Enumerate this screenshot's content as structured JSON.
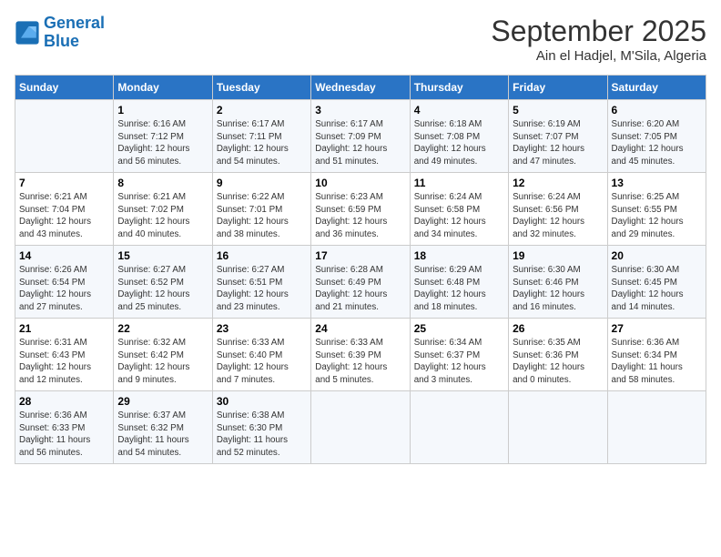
{
  "logo": {
    "line1": "General",
    "line2": "Blue"
  },
  "title": "September 2025",
  "subtitle": "Ain el Hadjel, M'Sila, Algeria",
  "days_of_week": [
    "Sunday",
    "Monday",
    "Tuesday",
    "Wednesday",
    "Thursday",
    "Friday",
    "Saturday"
  ],
  "weeks": [
    [
      {
        "day": "",
        "info": ""
      },
      {
        "day": "1",
        "info": "Sunrise: 6:16 AM\nSunset: 7:12 PM\nDaylight: 12 hours\nand 56 minutes."
      },
      {
        "day": "2",
        "info": "Sunrise: 6:17 AM\nSunset: 7:11 PM\nDaylight: 12 hours\nand 54 minutes."
      },
      {
        "day": "3",
        "info": "Sunrise: 6:17 AM\nSunset: 7:09 PM\nDaylight: 12 hours\nand 51 minutes."
      },
      {
        "day": "4",
        "info": "Sunrise: 6:18 AM\nSunset: 7:08 PM\nDaylight: 12 hours\nand 49 minutes."
      },
      {
        "day": "5",
        "info": "Sunrise: 6:19 AM\nSunset: 7:07 PM\nDaylight: 12 hours\nand 47 minutes."
      },
      {
        "day": "6",
        "info": "Sunrise: 6:20 AM\nSunset: 7:05 PM\nDaylight: 12 hours\nand 45 minutes."
      }
    ],
    [
      {
        "day": "7",
        "info": "Sunrise: 6:21 AM\nSunset: 7:04 PM\nDaylight: 12 hours\nand 43 minutes."
      },
      {
        "day": "8",
        "info": "Sunrise: 6:21 AM\nSunset: 7:02 PM\nDaylight: 12 hours\nand 40 minutes."
      },
      {
        "day": "9",
        "info": "Sunrise: 6:22 AM\nSunset: 7:01 PM\nDaylight: 12 hours\nand 38 minutes."
      },
      {
        "day": "10",
        "info": "Sunrise: 6:23 AM\nSunset: 6:59 PM\nDaylight: 12 hours\nand 36 minutes."
      },
      {
        "day": "11",
        "info": "Sunrise: 6:24 AM\nSunset: 6:58 PM\nDaylight: 12 hours\nand 34 minutes."
      },
      {
        "day": "12",
        "info": "Sunrise: 6:24 AM\nSunset: 6:56 PM\nDaylight: 12 hours\nand 32 minutes."
      },
      {
        "day": "13",
        "info": "Sunrise: 6:25 AM\nSunset: 6:55 PM\nDaylight: 12 hours\nand 29 minutes."
      }
    ],
    [
      {
        "day": "14",
        "info": "Sunrise: 6:26 AM\nSunset: 6:54 PM\nDaylight: 12 hours\nand 27 minutes."
      },
      {
        "day": "15",
        "info": "Sunrise: 6:27 AM\nSunset: 6:52 PM\nDaylight: 12 hours\nand 25 minutes."
      },
      {
        "day": "16",
        "info": "Sunrise: 6:27 AM\nSunset: 6:51 PM\nDaylight: 12 hours\nand 23 minutes."
      },
      {
        "day": "17",
        "info": "Sunrise: 6:28 AM\nSunset: 6:49 PM\nDaylight: 12 hours\nand 21 minutes."
      },
      {
        "day": "18",
        "info": "Sunrise: 6:29 AM\nSunset: 6:48 PM\nDaylight: 12 hours\nand 18 minutes."
      },
      {
        "day": "19",
        "info": "Sunrise: 6:30 AM\nSunset: 6:46 PM\nDaylight: 12 hours\nand 16 minutes."
      },
      {
        "day": "20",
        "info": "Sunrise: 6:30 AM\nSunset: 6:45 PM\nDaylight: 12 hours\nand 14 minutes."
      }
    ],
    [
      {
        "day": "21",
        "info": "Sunrise: 6:31 AM\nSunset: 6:43 PM\nDaylight: 12 hours\nand 12 minutes."
      },
      {
        "day": "22",
        "info": "Sunrise: 6:32 AM\nSunset: 6:42 PM\nDaylight: 12 hours\nand 9 minutes."
      },
      {
        "day": "23",
        "info": "Sunrise: 6:33 AM\nSunset: 6:40 PM\nDaylight: 12 hours\nand 7 minutes."
      },
      {
        "day": "24",
        "info": "Sunrise: 6:33 AM\nSunset: 6:39 PM\nDaylight: 12 hours\nand 5 minutes."
      },
      {
        "day": "25",
        "info": "Sunrise: 6:34 AM\nSunset: 6:37 PM\nDaylight: 12 hours\nand 3 minutes."
      },
      {
        "day": "26",
        "info": "Sunrise: 6:35 AM\nSunset: 6:36 PM\nDaylight: 12 hours\nand 0 minutes."
      },
      {
        "day": "27",
        "info": "Sunrise: 6:36 AM\nSunset: 6:34 PM\nDaylight: 11 hours\nand 58 minutes."
      }
    ],
    [
      {
        "day": "28",
        "info": "Sunrise: 6:36 AM\nSunset: 6:33 PM\nDaylight: 11 hours\nand 56 minutes."
      },
      {
        "day": "29",
        "info": "Sunrise: 6:37 AM\nSunset: 6:32 PM\nDaylight: 11 hours\nand 54 minutes."
      },
      {
        "day": "30",
        "info": "Sunrise: 6:38 AM\nSunset: 6:30 PM\nDaylight: 11 hours\nand 52 minutes."
      },
      {
        "day": "",
        "info": ""
      },
      {
        "day": "",
        "info": ""
      },
      {
        "day": "",
        "info": ""
      },
      {
        "day": "",
        "info": ""
      }
    ]
  ]
}
